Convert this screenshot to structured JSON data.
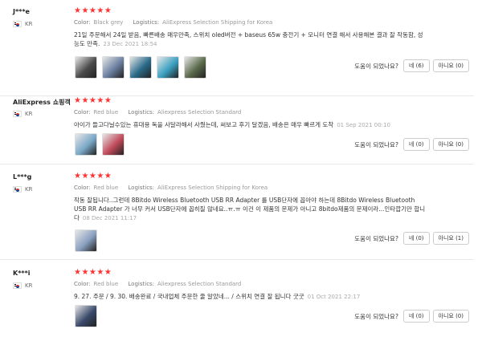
{
  "labels": {
    "color": "Color:",
    "logistics": "Logistics:",
    "helpful": "도움이 되었나요?"
  },
  "stars": "★★★★★",
  "reviews": [
    {
      "user": "J***e",
      "country": "KR",
      "color": "Black grey",
      "logistics": "AliExpress Selection Shipping for Korea",
      "text": "21일 주문해서 24일 받음, 빠른배송 매우만족, 스위치 oled버전 + baseus 65w 충전기 + 모니터 연결 해서 사용해본 결과 잘 작동함, 성능도 만족.",
      "date": "23 Dec 2021 18:54",
      "yes": "네 (6)",
      "no": "아니요 (0)"
    },
    {
      "user": "AliExpress 쇼핑객",
      "country": "KR",
      "color": "Red blue",
      "logistics": "Aliexpress Selection Standard",
      "text": "아이가 들고다닐수있는 휴대용 독을 사달라해서 사줬는데, 써보고 후기 달겠음, 배송은 매우 빠르게 도착",
      "date": "01 Sep 2021 00:10",
      "yes": "네 (0)",
      "no": "아니요 (0)"
    },
    {
      "user": "L***g",
      "country": "KR",
      "color": "Red blue",
      "logistics": "AliExpress Selection Shipping for Korea",
      "text": "작동 잘됩니다..그런데 8Bitdo Wireless Bluetooth USB RR Adapter 를 USB단자에 꼽아야 하는데 8Bitdo Wireless Bluetooth USB RR Adapter 가 너무 커서 USB단자에 꼽히질 않네요..ㅠ.ㅠ 이건 이 제품의 문제가 아니고 8bitdo제품의 문제이라...인타깝기만 합니다",
      "date": "08 Dec 2021 11:17",
      "yes": "네 (0)",
      "no": "아니요 (1)"
    },
    {
      "user": "K***i",
      "country": "KR",
      "color": "Red blue",
      "logistics": "Aliexpress Selection Standard",
      "text": "9. 27. 주문 / 9. 30. 배송완료 / 국내업체 주문한 줄 알았네... / 스위치 연결 잘 됩니다 굿굿",
      "date": "01 Oct 2021 22:17",
      "yes": "네 (0)",
      "no": "아니요 (0)"
    }
  ],
  "thumb_colors": [
    [
      "#4a4a4a",
      "#6b7fa0",
      "#2a6b8a",
      "#3aa0c0",
      "#5a6a4a"
    ],
    [
      "#7aa8c8",
      "#c04a5a"
    ],
    [
      "#8aa0c0"
    ],
    [
      "#3a4a6a"
    ]
  ]
}
